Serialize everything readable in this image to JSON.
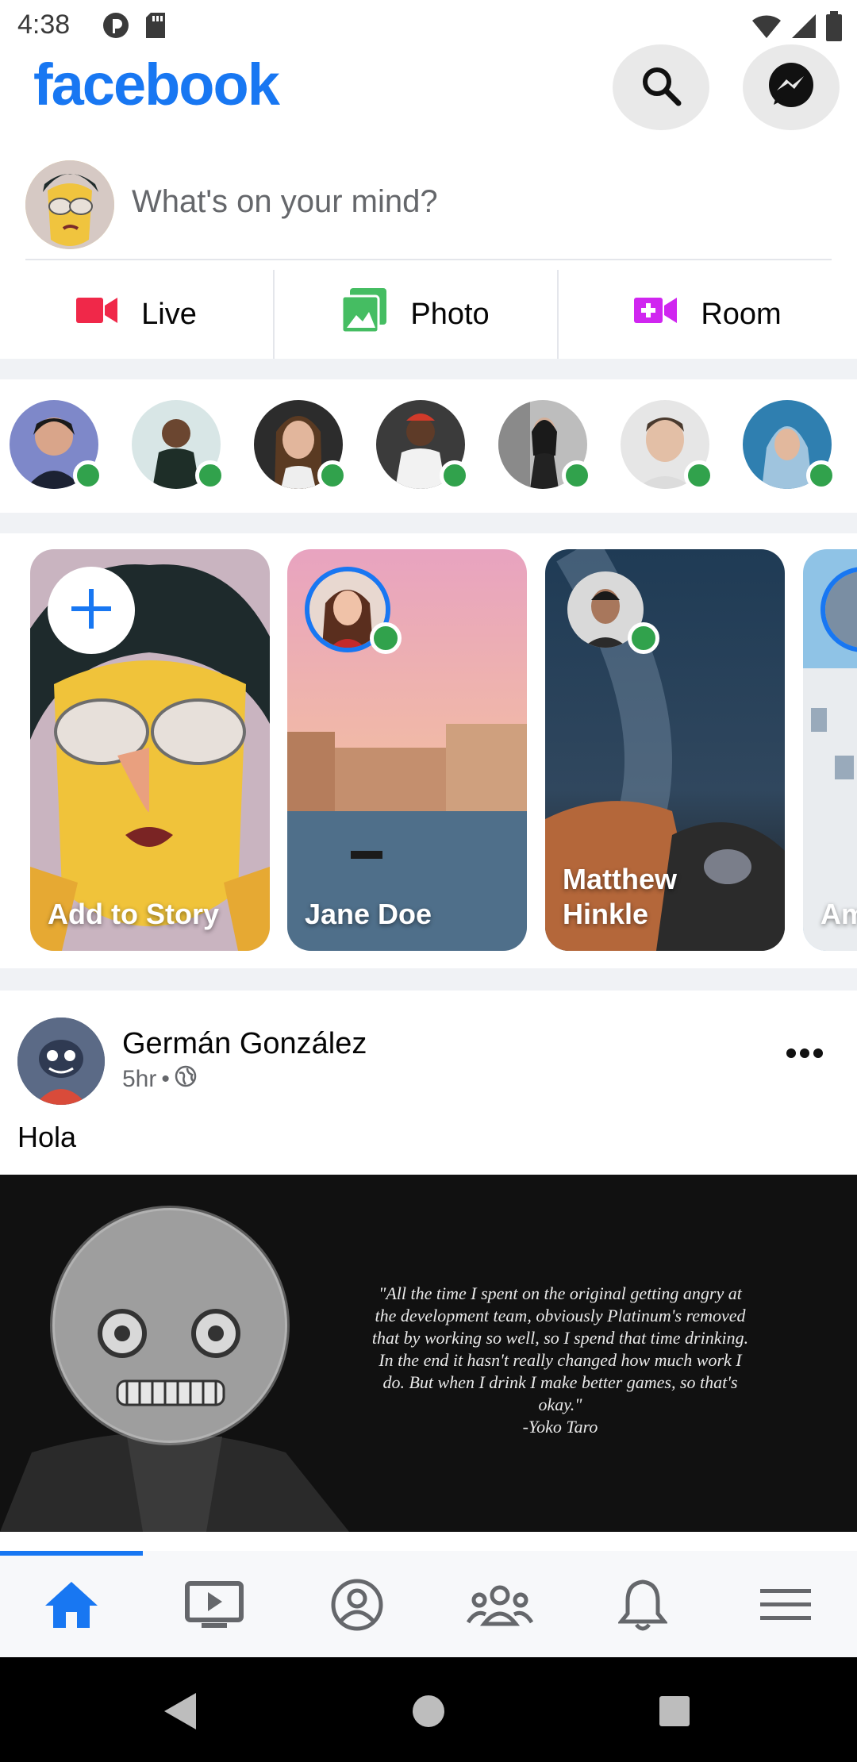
{
  "status_bar": {
    "time": "4:38",
    "left_icons": [
      "pocket-casts-icon",
      "sd-card-icon"
    ],
    "right_icons": [
      "wifi-icon",
      "signal-icon",
      "battery-icon"
    ]
  },
  "header": {
    "logo_text": "facebook",
    "search_icon": "search-icon",
    "messenger_icon": "messenger-icon",
    "brand_color": "#1877f2"
  },
  "composer": {
    "placeholder": "What's on your mind?"
  },
  "actions": [
    {
      "label": "Live",
      "icon": "video-camera-icon",
      "color": "#f02849"
    },
    {
      "label": "Photo",
      "icon": "photo-icon",
      "color": "#45bd62"
    },
    {
      "label": "Room",
      "icon": "video-plus-icon",
      "color": "#d026f0"
    }
  ],
  "stories": [
    {
      "name": "Add to Story"
    },
    {
      "name": "Jane Doe"
    },
    {
      "name": "Matthew Hinkle"
    },
    {
      "name": "Am"
    }
  ],
  "post": {
    "author": "Germán González",
    "time": "5hr",
    "separator": "•",
    "text": "Hola",
    "quote": "\"All the time I spent on the original getting angry at the development team, obviously Platinum's removed that by working so well, so I spend that time drinking. In the end it hasn't really changed how much work I do. But when I drink I make better games, so that's okay.\"",
    "quote_author": "-Yoko Taro"
  },
  "bottom_nav": {
    "items": [
      "home-icon",
      "watch-icon",
      "profile-icon",
      "groups-icon",
      "notifications-icon",
      "menu-icon"
    ],
    "active": "home-icon"
  },
  "colors": {
    "online": "#31a24c",
    "secondary_text": "#65676b",
    "divider": "#f0f2f5"
  }
}
